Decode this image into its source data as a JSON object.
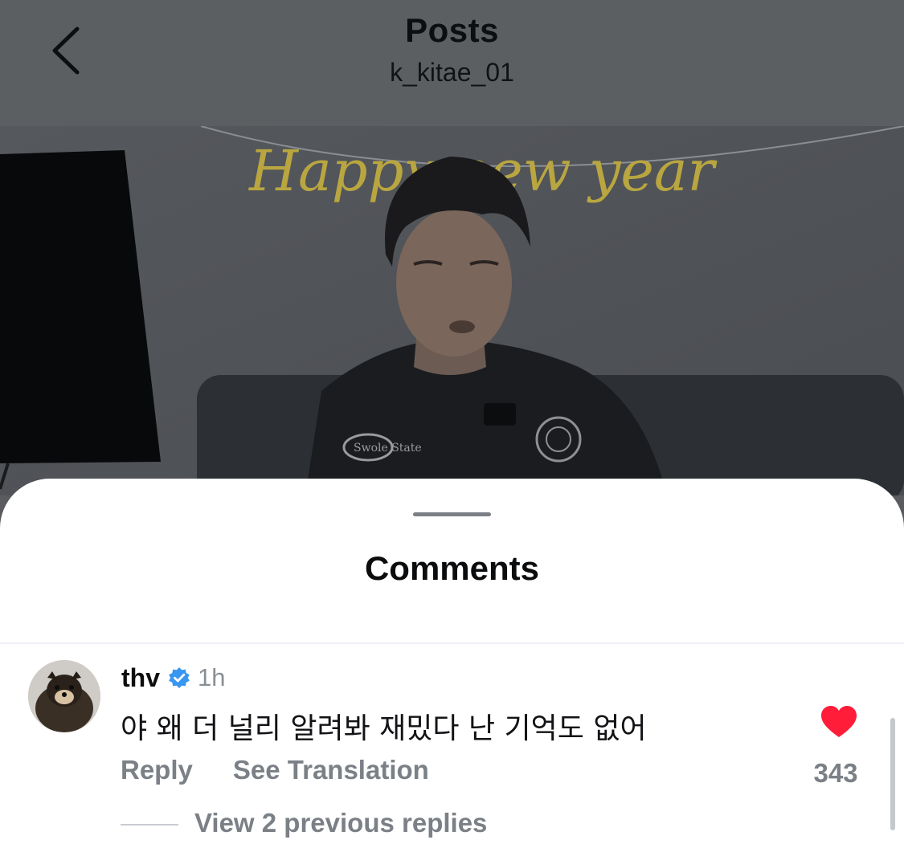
{
  "header": {
    "title": "Posts",
    "username": "k_kitae_01",
    "back_icon": "chevron-left-icon"
  },
  "post": {
    "banner_text": "Happy new year",
    "shirt_patch_text": "Swole State"
  },
  "comments_sheet": {
    "title": "Comments",
    "comments": [
      {
        "username": "thv",
        "verified": true,
        "time": "1h",
        "text": "야 왜 더 널리 알려봐 재밌다 난 기억도 없어",
        "likes": "343",
        "reply_label": "Reply",
        "translate_label": "See Translation",
        "liked": true,
        "view_replies_label": "View 2 previous replies"
      }
    ]
  },
  "colors": {
    "heart": "#ff1d3a",
    "verified": "#3897f0",
    "header_bg": "#5c5f62",
    "sheet_bg": "#ffffff"
  }
}
